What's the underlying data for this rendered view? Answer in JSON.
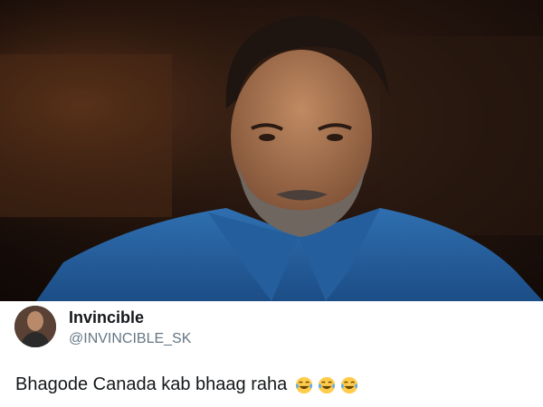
{
  "tweet": {
    "display_name": "Invincible",
    "handle": "@INVINCIBLE_SK",
    "text": "Bhagode Canada kab bhaag raha",
    "emojis": [
      "face-with-tears-of-joy-icon",
      "face-with-tears-of-joy-icon",
      "face-with-tears-of-joy-icon"
    ]
  }
}
